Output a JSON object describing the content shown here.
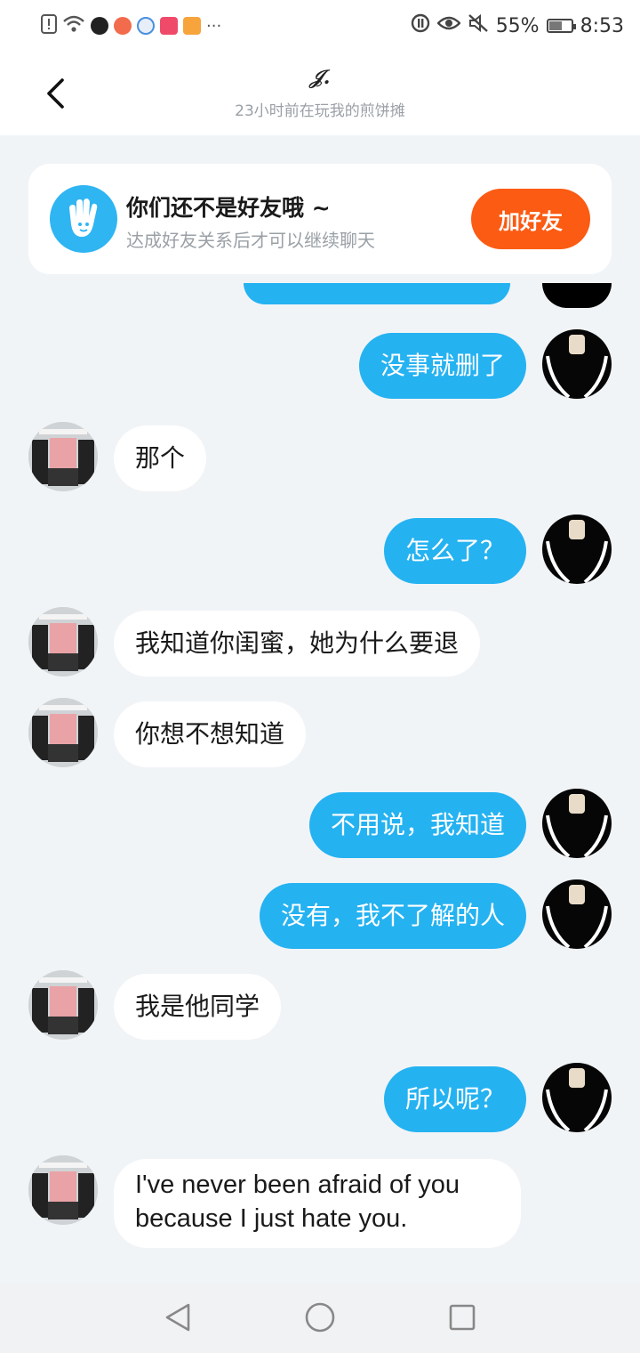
{
  "status_bar": {
    "battery": "55%",
    "battery_level": 0.55,
    "time": "8:53",
    "overflow": "···"
  },
  "header": {
    "name": "𝒥.",
    "status": "23小时前在玩我的煎饼摊"
  },
  "friend_card": {
    "title": "你们还不是好友哦 ~",
    "subtitle": "达成好友关系后才可以继续聊天",
    "button_label": "加好友"
  },
  "messages": [
    {
      "from": "me",
      "text": "没事就删了"
    },
    {
      "from": "them",
      "text": "那个"
    },
    {
      "from": "me",
      "text": "怎么了？"
    },
    {
      "from": "them",
      "text": "我知道你闺蜜，她为什么要退"
    },
    {
      "from": "them",
      "text": "你想不想知道"
    },
    {
      "from": "me",
      "text": "不用说，我知道"
    },
    {
      "from": "me",
      "text": "没有，我不了解的人"
    },
    {
      "from": "them",
      "text": "我是他同学"
    },
    {
      "from": "me",
      "text": "所以呢？"
    },
    {
      "from": "them",
      "text": " I've never been afraid of you\nbecause I just hate you."
    }
  ],
  "colors": {
    "my_bubble": "#25b2f1",
    "their_bubble": "#ffffff",
    "add_friend_button": "#fb5b13",
    "background": "#f1f4f7"
  },
  "icons": {
    "back": "chevron-left-icon",
    "friend_card": "waving-hand-icon",
    "nav": [
      "back-triangle-icon",
      "home-circle-icon",
      "recents-square-icon"
    ]
  }
}
